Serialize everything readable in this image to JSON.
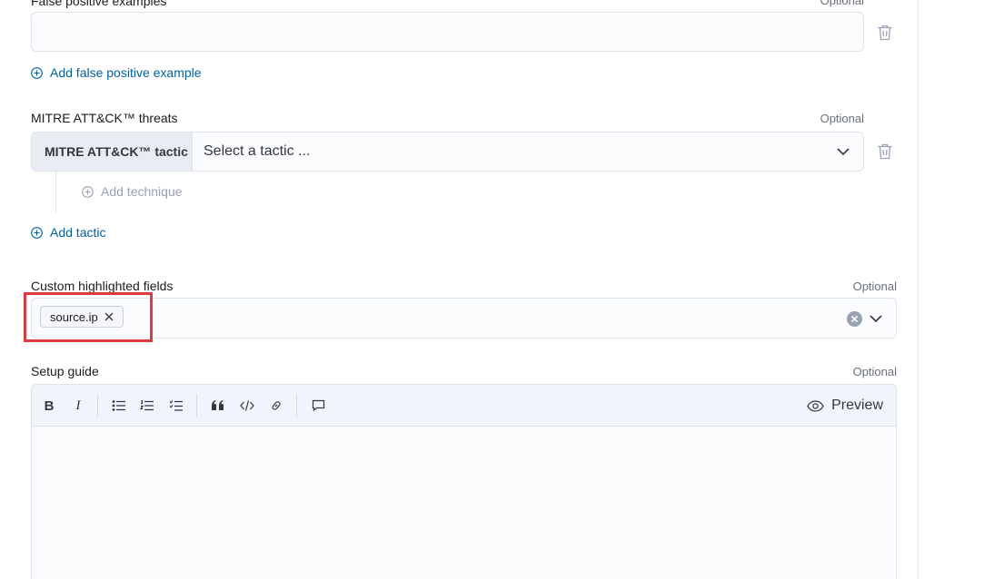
{
  "false_positive": {
    "label": "False positive examples",
    "optional": "Optional",
    "add_link": "Add false positive example"
  },
  "mitre": {
    "label": "MITRE ATT&CK™ threats",
    "optional": "Optional",
    "tactic_prepend": "MITRE ATT&CK™ tactic",
    "tactic_placeholder": "Select a tactic ...",
    "add_technique": "Add technique",
    "add_tactic": "Add tactic"
  },
  "custom_fields": {
    "label": "Custom highlighted fields",
    "optional": "Optional",
    "chips": [
      "source.ip"
    ]
  },
  "setup_guide": {
    "label": "Setup guide",
    "optional": "Optional",
    "toolbar": {
      "bold": "B",
      "italic": "I",
      "preview": "Preview"
    }
  },
  "colors": {
    "accent_link": "#0061a6",
    "highlight_border": "#e0393e",
    "field_background": "#fbfcfd"
  }
}
